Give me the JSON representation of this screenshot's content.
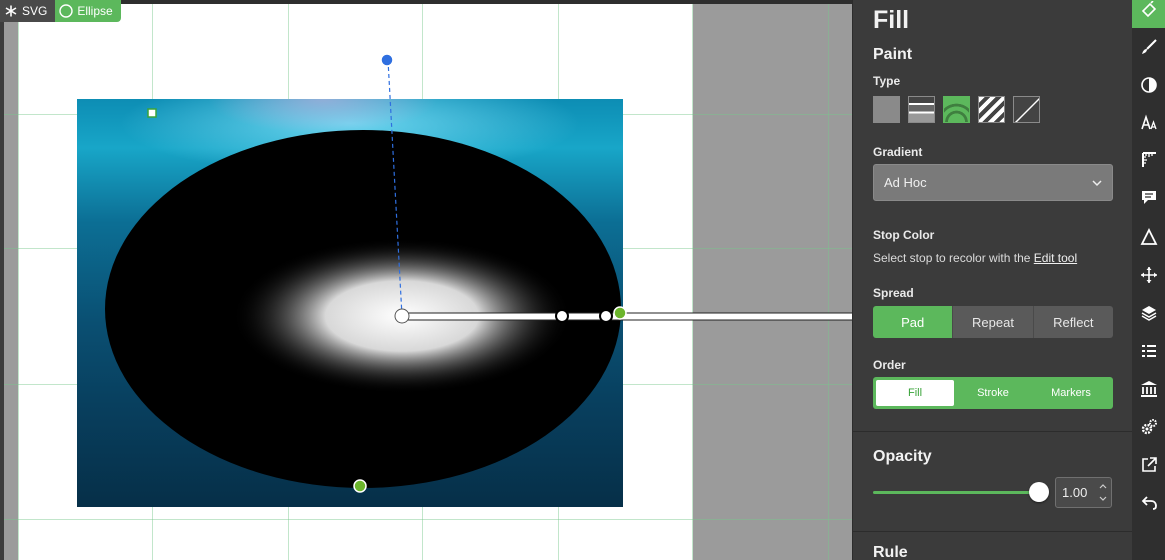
{
  "breadcrumb": {
    "root": "SVG",
    "current": "Ellipse"
  },
  "panel": {
    "title": "Fill",
    "paint_title": "Paint",
    "type_label": "Type",
    "gradient_label": "Gradient",
    "gradient_value": "Ad Hoc",
    "stop_color_label": "Stop Color",
    "stop_hint": "Select stop to recolor with the",
    "stop_hint_link": "Edit tool",
    "spread_label": "Spread",
    "spread_options": [
      "Pad",
      "Repeat",
      "Reflect"
    ],
    "spread_selected": "Pad",
    "order_label": "Order",
    "order_options": [
      "Fill",
      "Stroke",
      "Markers"
    ],
    "order_selected": "Fill",
    "opacity_title": "Opacity",
    "opacity_value": "1.00",
    "opacity_level": 1.0,
    "rule_title": "Rule"
  },
  "tools": [
    "fill-tool-icon",
    "brush-icon",
    "contrast-icon",
    "text-style-icon",
    "ruler-icon",
    "comment-icon",
    "triangle-icon",
    "move-icon",
    "layers-icon",
    "list-icon",
    "library-icon",
    "settings-gears-icon",
    "export-icon",
    "undo-icon"
  ],
  "colors": {
    "accent": "#5cb85c",
    "panel": "#3b3b3b",
    "toolbar": "#2f2f2f",
    "canvas": "#9b9b9b",
    "handle_blue": "#2f6fe0"
  }
}
